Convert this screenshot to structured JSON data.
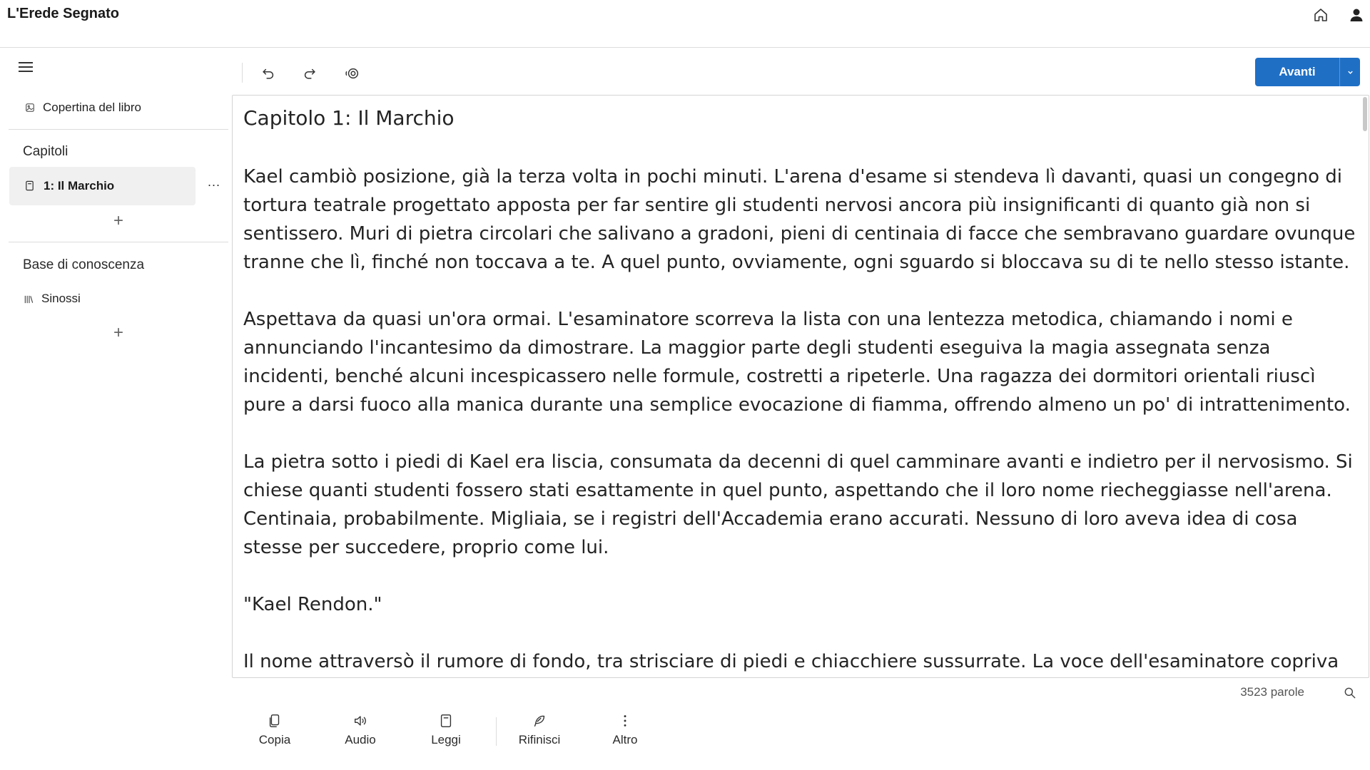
{
  "app": {
    "title": "L'Erede Segnato",
    "icons": {
      "home": "home-icon",
      "user": "user-icon"
    }
  },
  "sidebar": {
    "menu_icon": "hamburger-icon",
    "cover": {
      "label": "Copertina del libro",
      "icon": "image-icon"
    },
    "chapters": {
      "heading": "Capitoli",
      "items": [
        {
          "label": "1: Il Marchio",
          "icon": "document-icon",
          "active": true
        }
      ],
      "more_label": "...",
      "add_label": "+"
    },
    "knowledge_base": {
      "heading": "Base di conoscenza",
      "items": [
        {
          "label": "Sinossi",
          "icon": "library-icon"
        }
      ],
      "add_label": "+"
    }
  },
  "toolbar": {
    "undo_icon": "undo-icon",
    "redo_icon": "redo-icon",
    "view_icon": "eye-icon",
    "primary_label": "Avanti",
    "accent": "#1f6fc5"
  },
  "editor": {
    "chapter_title": "Capitolo 1: Il Marchio",
    "paragraphs": [
      "Kael cambiò posizione, già la terza volta in pochi minuti. L'arena d'esame si stendeva lì davanti, quasi un congegno di tortura teatrale progettato apposta per far sentire gli studenti nervosi ancora più insignificanti di quanto già non si sentissero. Muri di pietra circolari che salivano a gradoni, pieni di centinaia di facce che sembravano guardare ovunque tranne che lì, finché non toccava a te. A quel punto, ovviamente, ogni sguardo si bloccava su di te nello stesso istante.",
      "Aspettava da quasi un'ora ormai. L'esaminatore scorreva la lista con una lentezza metodica, chiamando i nomi e annunciando l'incantesimo da dimostrare. La maggior parte degli studenti eseguiva la magia assegnata senza incidenti, benché alcuni incespicassero nelle formule, costretti a ripeterle. Una ragazza dei dormitori orientali riuscì pure a darsi fuoco alla manica durante una semplice evocazione di fiamma, offrendo almeno un po' di intrattenimento.",
      "La pietra sotto i piedi di Kael era liscia, consumata da decenni di quel camminare avanti e indietro per il nervosismo. Si chiese quanti studenti fossero stati esattamente in quel punto, aspettando che il loro nome riecheggiasse nell'arena. Centinaia, probabilmente. Migliaia, se i registri dell'Accademia erano accurati. Nessuno di loro aveva idea di cosa stesse per succedere, proprio come lui.",
      "\"Kael Rendon.\"",
      "Il nome attraversò il rumore di fondo, tra strisciare di piedi e chiacchiere sussurrate. La voce dell'esaminatore copriva"
    ]
  },
  "status": {
    "word_count": "3523 parole",
    "search_icon": "search-icon"
  },
  "bottom_bar": {
    "actions": [
      {
        "label": "Copia",
        "icon": "copy-icon"
      },
      {
        "label": "Audio",
        "icon": "speaker-icon"
      },
      {
        "label": "Leggi",
        "icon": "book-icon"
      },
      {
        "label": "Rifinisci",
        "icon": "feather-icon"
      },
      {
        "label": "Altro",
        "icon": "more-vertical-icon"
      }
    ]
  }
}
